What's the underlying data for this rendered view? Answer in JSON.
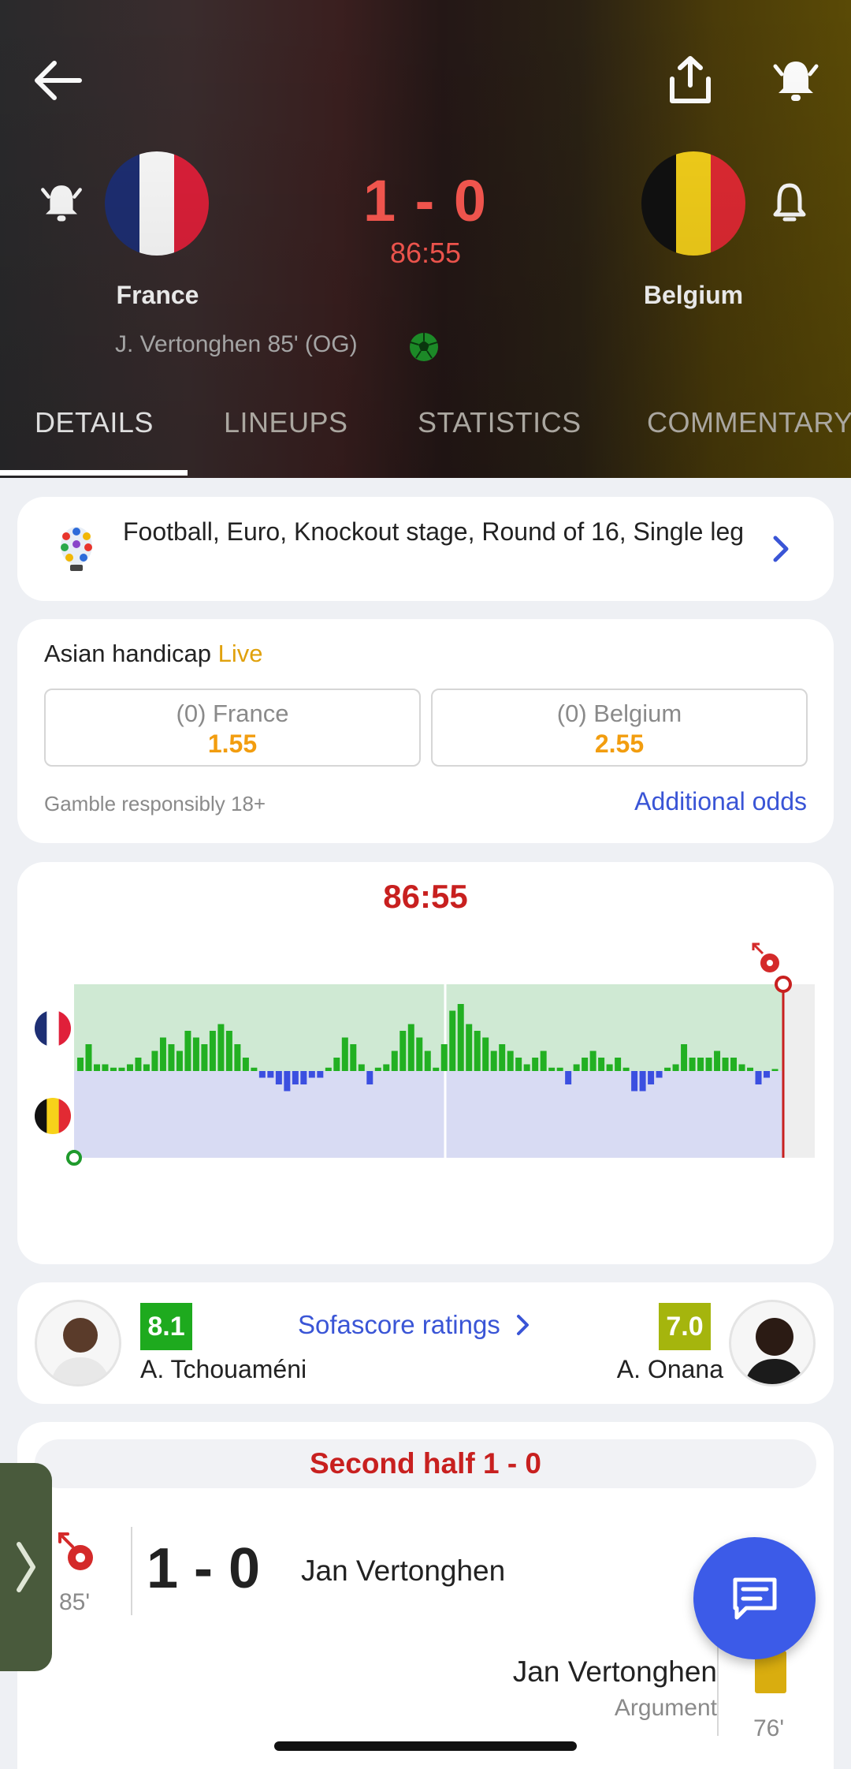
{
  "header": {
    "home_team": "France",
    "away_team": "Belgium",
    "score": "1 - 0",
    "clock": "86:55",
    "scorer": "J. Vertonghen 85' (OG)",
    "icons": [
      "back-arrow-icon",
      "share-icon",
      "bell-ringing-icon",
      "bell-icon",
      "football-icon"
    ]
  },
  "tabs": [
    {
      "label": "DETAILS",
      "active": true
    },
    {
      "label": "LINEUPS",
      "active": false
    },
    {
      "label": "STATISTICS",
      "active": false
    },
    {
      "label": "COMMENTARY",
      "active": false
    }
  ],
  "competition": {
    "text": "Football, Euro, Knockout stage, Round of 16, Single leg"
  },
  "odds": {
    "title": "Asian handicap",
    "live_label": "Live",
    "home_label": "(0) France",
    "home_value": "1.55",
    "away_label": "(0) Belgium",
    "away_value": "2.55",
    "gamble_text": "Gamble responsibly 18+",
    "additional_odds": "Additional odds"
  },
  "momentum": {
    "time": "86:55",
    "colors": {
      "home_bg": "#cfe9d3",
      "away_bg": "#d8dbf3",
      "home_bar": "#22b022",
      "away_bar": "#3b4fe0",
      "marker": "#c8201f"
    },
    "values": [
      2,
      4,
      1,
      1,
      0.5,
      0.5,
      1,
      2,
      1,
      3,
      5,
      4,
      3,
      6,
      5,
      4,
      6,
      7,
      6,
      4,
      2,
      0.5,
      -1,
      -1,
      -2,
      -3,
      -2,
      -2,
      -1,
      -1,
      0.5,
      2,
      5,
      4,
      1,
      -2,
      0.5,
      1,
      3,
      6,
      7,
      5,
      3,
      0.5,
      4,
      9,
      10,
      7,
      6,
      5,
      3,
      4,
      3,
      2,
      1,
      2,
      3,
      0.5,
      0.5,
      -2,
      1,
      2,
      3,
      2,
      1,
      2,
      0.5,
      -3,
      -3,
      -2,
      -1,
      0.5,
      1,
      4,
      2,
      2,
      2,
      3,
      2,
      2,
      1,
      0.5,
      -2,
      -1,
      0.3
    ]
  },
  "ratings": {
    "link_text": "Sofascore ratings",
    "home_player": "A. Tchouaméni",
    "home_rating": "8.1",
    "home_rating_color": "#1eaa1e",
    "away_player": "A. Onana",
    "away_rating": "7.0",
    "away_rating_color": "#a5b50d"
  },
  "events": {
    "half_label": "Second half 1 - 0",
    "goal": {
      "minute": "85'",
      "score": "1 - 0",
      "player": "Jan Vertonghen"
    },
    "card": {
      "player": "Jan Vertonghen",
      "reason": "Argument",
      "minute": "76'"
    }
  }
}
